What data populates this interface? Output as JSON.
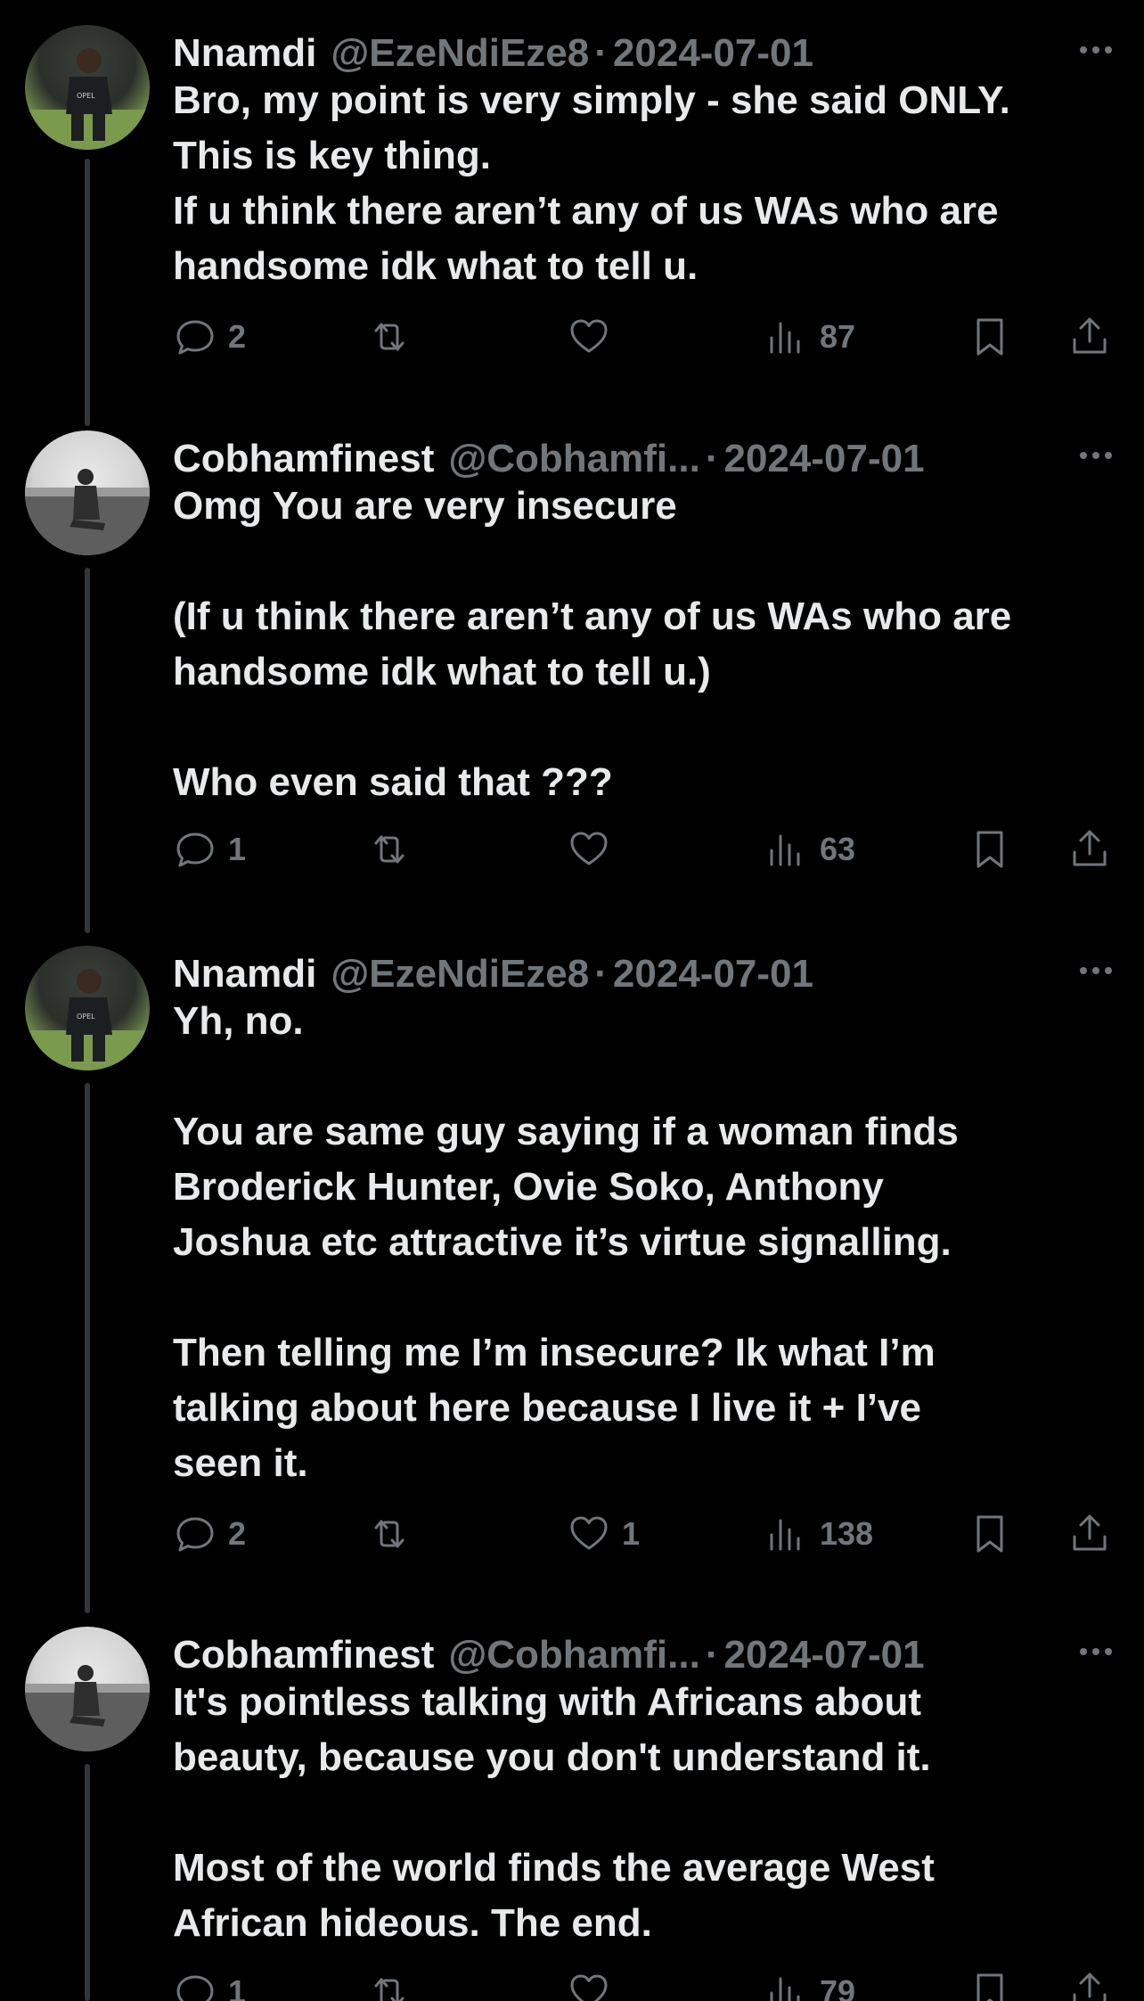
{
  "tweets": [
    {
      "name": "Nnamdi",
      "handle": "@EzeNdiEze8",
      "separator": "·",
      "date": "2024-07-01",
      "text": "Bro, my point is very simply - she said ONLY.\nThis is key thing.\nIf u think there aren’t any of us WAs who are\nhandsome idk what to tell u.",
      "replies": "2",
      "reposts": "",
      "likes": "",
      "views": "87"
    },
    {
      "name": "Cobhamfinest",
      "handle": "@Cobhamfi...",
      "separator": "·",
      "date": "2024-07-01",
      "text": "Omg You are very insecure\n\n(If u think there aren’t any of us WAs who are\nhandsome idk what to tell u.)\n\nWho even said that ???",
      "replies": "1",
      "reposts": "",
      "likes": "",
      "views": "63"
    },
    {
      "name": "Nnamdi",
      "handle": "@EzeNdiEze8",
      "separator": "·",
      "date": "2024-07-01",
      "text": "Yh, no.\n\nYou are same guy saying if a woman finds\nBroderick Hunter, Ovie Soko, Anthony\nJoshua etc attractive it’s virtue signalling.\n\nThen telling me I’m insecure? Ik what I’m\ntalking about here because I live it + I’ve\nseen it.",
      "replies": "2",
      "reposts": "",
      "likes": "1",
      "views": "138"
    },
    {
      "name": "Cobhamfinest",
      "handle": "@Cobhamfi...",
      "separator": "·",
      "date": "2024-07-01",
      "text": "It's pointless talking with Africans about\nbeauty, because you don't understand it.\n\nMost of the world finds the average West\nAfrican hideous. The end.",
      "replies": "1",
      "reposts": "",
      "likes": "",
      "views": "79"
    }
  ],
  "icons": {
    "reply": "reply-icon",
    "repost": "repost-icon",
    "like": "heart-icon",
    "views": "views-icon",
    "bookmark": "bookmark-icon",
    "share": "share-icon",
    "more": "more-icon"
  },
  "colors": {
    "background": "#000000",
    "text": "#e7e9ea",
    "secondary": "#71767b",
    "thread_line": "#333639"
  }
}
